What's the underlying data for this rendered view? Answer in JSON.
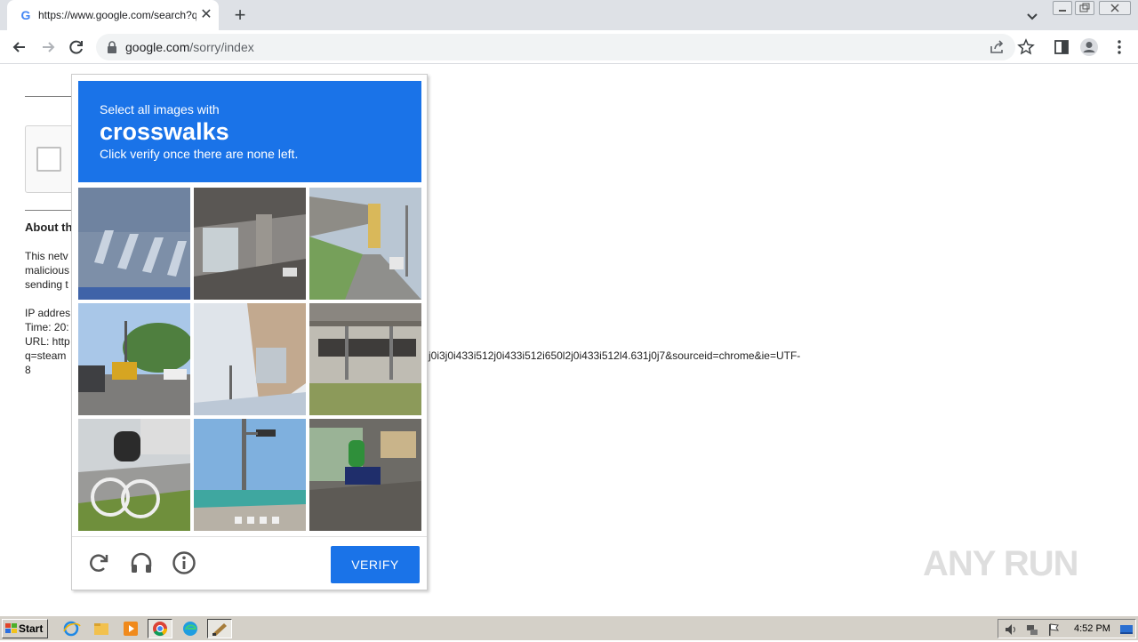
{
  "browser": {
    "tab": {
      "title": "https://www.google.com/search?q=",
      "favicon": "google-g-icon"
    },
    "address": {
      "host": "google.com",
      "path": "/sorry/index"
    }
  },
  "page_behind": {
    "heading": "About th",
    "para": [
      "This netv",
      "malicious",
      "sending t"
    ],
    "info": [
      "IP addres",
      "Time: 20:",
      "URL: http",
      "q=steam"
    ],
    "url_tail": "j0i3j0i433i512j0i433i512i650l2j0i433i512l4.631j0j7&sourceid=chrome&ie=UTF-",
    "url_end": "8"
  },
  "captcha": {
    "line1": "Select all images with",
    "keyword": "crosswalks",
    "line3": "Click verify once there are none left.",
    "verify_label": "VERIFY",
    "tiles": [
      "crosswalk-stripes",
      "overpass-underside",
      "road-with-temple",
      "street-with-truck",
      "building-wall",
      "parking-lot",
      "cyclist",
      "traffic-light-crosswalk",
      "motorcyclist"
    ]
  },
  "watermark": "ANY RUN",
  "taskbar": {
    "start": "Start",
    "clock": "4:52 PM"
  },
  "colors": {
    "accent": "#1a73e8"
  }
}
